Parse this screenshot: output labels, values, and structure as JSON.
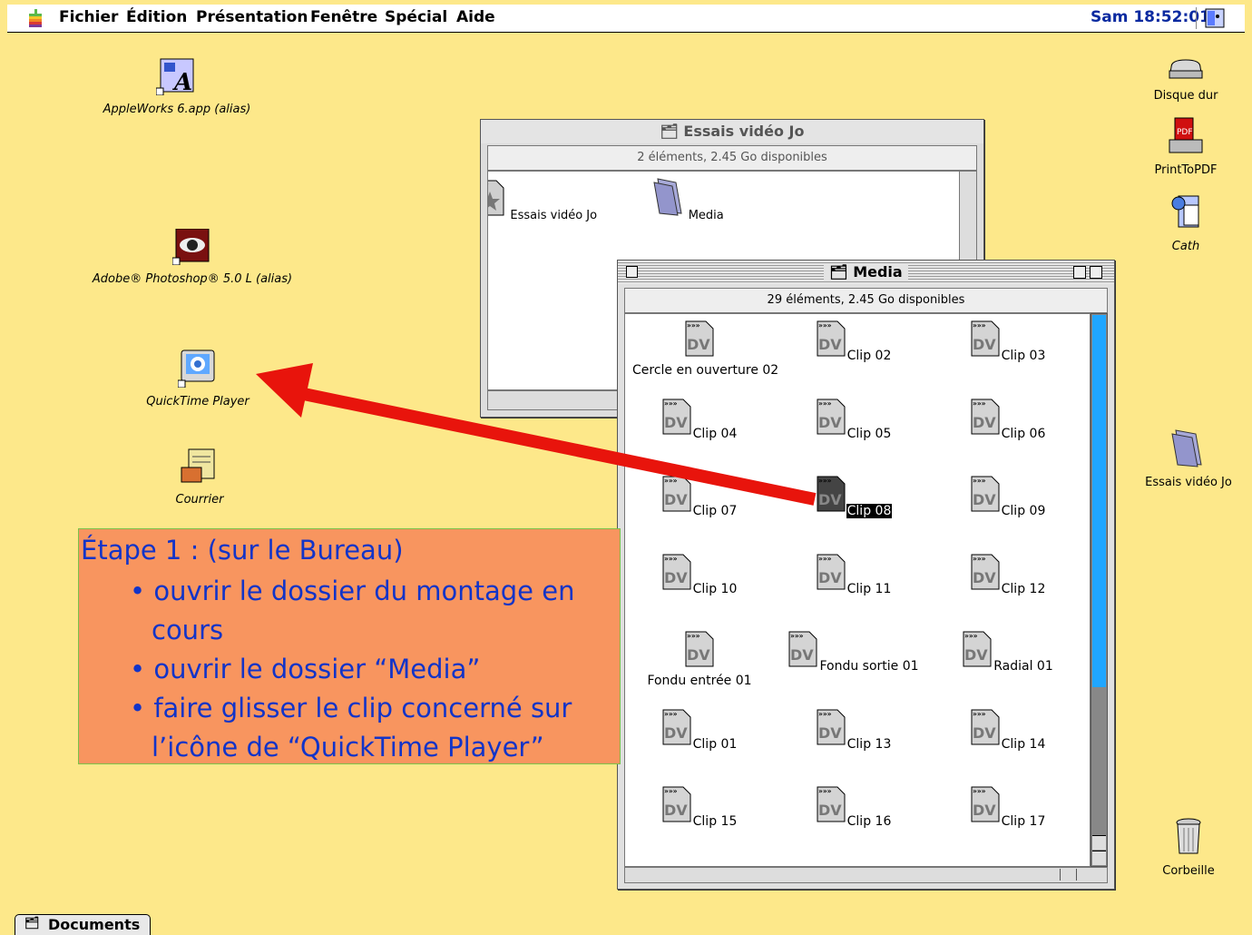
{
  "menubar": {
    "apple_icon": "apple-menu-icon",
    "items": [
      "Fichier",
      "Édition",
      "Présentation",
      "Fenêtre",
      "Spécial",
      "Aide"
    ],
    "clock": "Sam 18:52:01",
    "app_switcher_icon": "finder-icon"
  },
  "desktop": {
    "left_icons": [
      {
        "label": "AppleWorks 6.app (alias)",
        "icon": "appleworks-icon"
      },
      {
        "label": "Adobe® Photoshop® 5.0 L (alias)",
        "icon": "photoshop-eye-icon"
      },
      {
        "label": "QuickTime Player",
        "icon": "quicktime-icon"
      },
      {
        "label": "Courrier",
        "icon": "mail-icon"
      }
    ],
    "right_icons": [
      {
        "label": "Disque dur",
        "icon": "hard-disk-icon"
      },
      {
        "label": "PrintToPDF",
        "icon": "pdf-printer-icon"
      },
      {
        "label": "Cath",
        "icon": "user-folder-icon"
      },
      {
        "label": "Essais vidéo Jo",
        "icon": "folder-icon"
      },
      {
        "label": "Corbeille",
        "icon": "trash-icon"
      }
    ]
  },
  "window_back": {
    "title": "Essais vidéo Jo",
    "info": "2 éléments, 2.45 Go disponibles",
    "items": [
      {
        "label": "Essais vidéo Jo",
        "icon": "project-file-icon"
      },
      {
        "label": "Media",
        "icon": "folder-icon"
      }
    ]
  },
  "window_front": {
    "title": "Media",
    "info": "29 éléments, 2.45 Go disponibles",
    "selected": "Clip 08",
    "items": [
      "Cercle en ouverture 02",
      "Clip 02",
      "Clip 03",
      "Clip 04",
      "Clip 05",
      "Clip 06",
      "Clip 07",
      "Clip 08",
      "Clip 09",
      "Clip 10",
      "Clip 11",
      "Clip 12",
      "Fondu entrée 01",
      "Fondu sortie 01",
      "Radial 01",
      "Clip 01",
      "Clip 13",
      "Clip 14",
      "Clip 15",
      "Clip 16",
      "Clip 17"
    ],
    "doc_badge": "DV"
  },
  "annotation": {
    "title": "Étape 1 : (sur le Bureau)",
    "lines": [
      "• ouvrir le dossier du montage en",
      "cours",
      "• ouvrir le dossier “Media”",
      "• faire glisser le clip concerné sur",
      "l’icône de “QuickTime Player”"
    ]
  },
  "arrow_color": "#e8140c",
  "taskbar": {
    "documents_label": "Documents"
  }
}
